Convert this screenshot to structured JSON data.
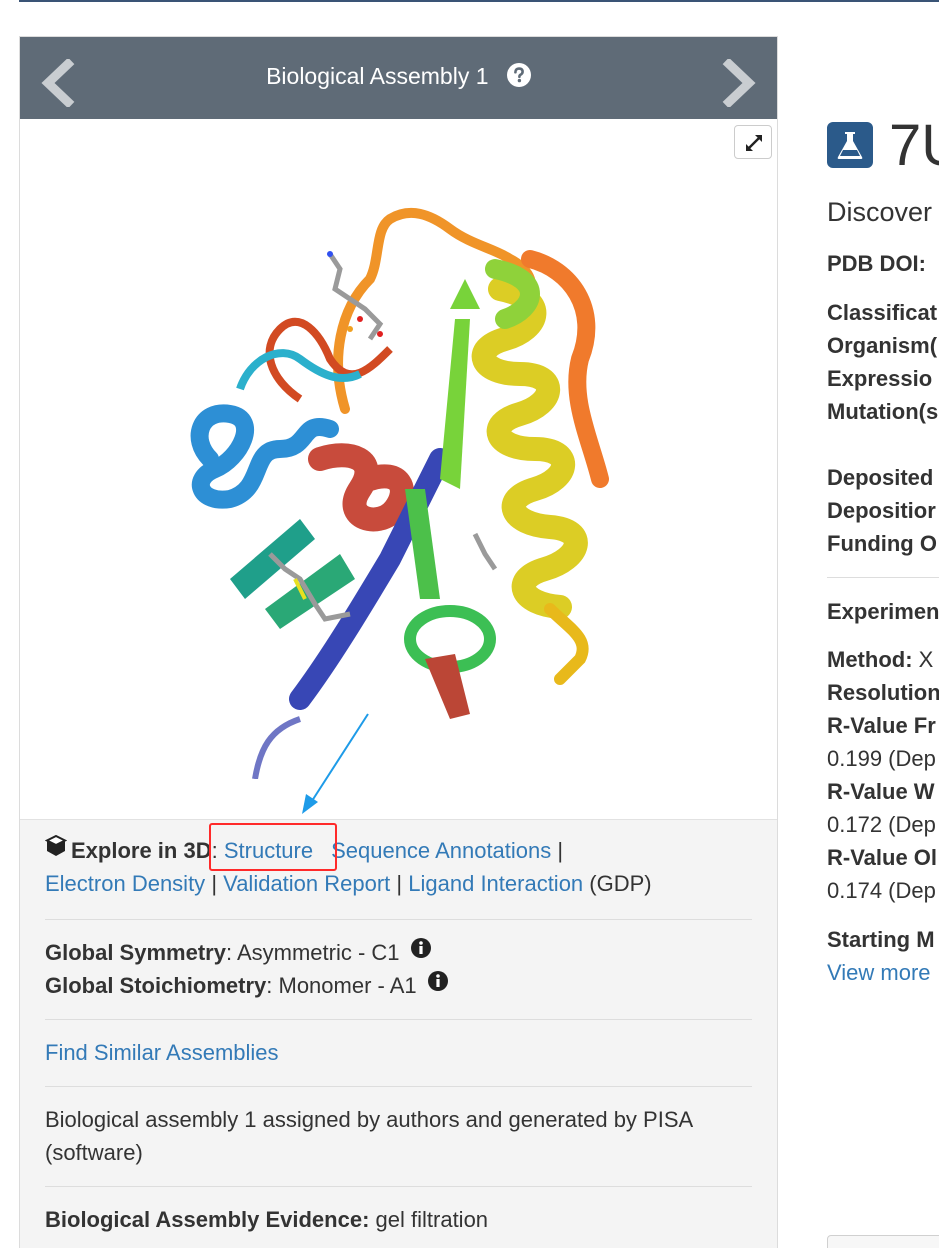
{
  "carousel": {
    "title": "Biological Assembly 1",
    "help_icon": "question-circle-icon",
    "prev_icon": "chevron-left-icon",
    "next_icon": "chevron-right-icon",
    "expand_icon": "expand-icon"
  },
  "explore": {
    "label": "Explore in 3D",
    "colon": ":",
    "links": {
      "structure": "Structure",
      "sequence_annotations": "Sequence Annotations",
      "electron_density": "Electron Density",
      "validation_report": "Validation Report",
      "ligand_interaction": "Ligand Interaction"
    },
    "separator": "|",
    "gdp": "(GDP)"
  },
  "symmetry": {
    "global_symmetry_label": "Global Symmetry",
    "global_symmetry_value": ": Asymmetric - C1",
    "global_stoichiometry_label": "Global Stoichiometry",
    "global_stoichiometry_value": ": Monomer - A1"
  },
  "find_similar": "Find Similar Assemblies",
  "assembly_note": "Biological assembly 1 assigned by authors and generated by PISA (software)",
  "evidence": {
    "label": "Biological Assembly Evidence:",
    "value": "gel filtration"
  },
  "right_panel": {
    "pdb_id": "7U",
    "subtitle": "Discover",
    "pdb_doi": "PDB DOI:",
    "classification": "Classificat",
    "organism": "Organism(",
    "expression": "Expressio",
    "mutation": "Mutation(s",
    "deposited": "Deposited",
    "deposition": "Depositior",
    "funding": "Funding O",
    "experimental": "Experimen",
    "method_label": "Method:",
    "method_value": "X",
    "resolution": "Resolution",
    "r_value_free_label": "R-Value Fr",
    "r_value_free_value": "0.199 (Dep",
    "r_value_work_label": "R-Value W",
    "r_value_work_value": "0.172 (Dep",
    "r_value_observed_label": "R-Value Ol",
    "r_value_observed_value": "0.174 (Dep",
    "starting_model": "Starting M",
    "view_more": "View more"
  },
  "colors": {
    "header_bg": "#5f6b77",
    "link": "#337ab7",
    "highlight": "#ff2a2a",
    "arrow": "#1e9be8",
    "badge": "#2b5a8a"
  }
}
